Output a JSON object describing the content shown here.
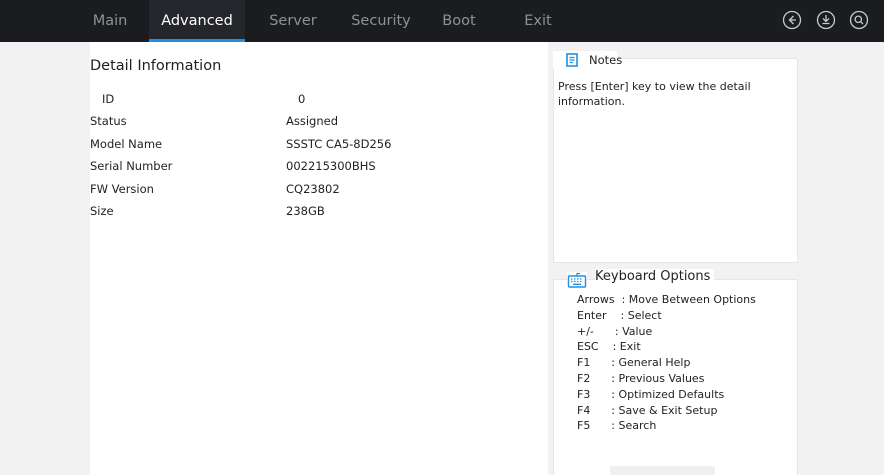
{
  "topbar": {
    "tabs": [
      {
        "label": "Main"
      },
      {
        "label": "Advanced"
      },
      {
        "label": "Server"
      },
      {
        "label": "Security"
      },
      {
        "label": "Boot"
      },
      {
        "label": "Exit"
      }
    ],
    "active_tab": "Advanced",
    "icons": [
      "back-icon",
      "download-icon",
      "search-icon"
    ]
  },
  "main": {
    "title": "Detail Information",
    "rows": [
      {
        "label": "ID",
        "value": "0"
      },
      {
        "label": "Status",
        "value": "Assigned"
      },
      {
        "label": "Model Name",
        "value": "SSSTC CA5-8D256"
      },
      {
        "label": "Serial Number",
        "value": "002215300BHS"
      },
      {
        "label": "FW Version",
        "value": "CQ23802"
      },
      {
        "label": "Size",
        "value": "238GB"
      }
    ]
  },
  "notes": {
    "title": "Notes",
    "text": "Press [Enter] key to view the detail information."
  },
  "keyboard": {
    "title": "Keyboard Options",
    "lines": [
      "Arrows  : Move Between Options",
      "Enter    : Select",
      "+/-      : Value",
      "ESC    : Exit",
      "F1      : General Help",
      "F2      : Previous Values",
      "F3      : Optimized Defaults",
      "F4      : Save & Exit Setup",
      "F5      : Search"
    ]
  },
  "colors": {
    "topbar_bg": "#1b1c20",
    "accent": "#1e90e6",
    "page_bg": "#f2f2f2",
    "panel_bg": "#ffffff"
  }
}
